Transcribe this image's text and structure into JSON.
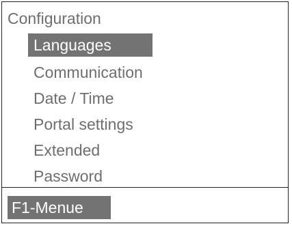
{
  "menu": {
    "title": "Configuration",
    "items": [
      {
        "label": "Languages",
        "selected": true
      },
      {
        "label": "Communication",
        "selected": false
      },
      {
        "label": "Date / Time",
        "selected": false
      },
      {
        "label": "Portal settings",
        "selected": false
      },
      {
        "label": "Extended",
        "selected": false
      },
      {
        "label": "Password",
        "selected": false
      }
    ]
  },
  "softkeys": {
    "f1_label": "F1-Menue"
  },
  "colors": {
    "highlight_bg": "#737373",
    "highlight_text": "#ffffff",
    "text": "#6e6e6e",
    "border": "#222222",
    "background": "#ffffff"
  }
}
